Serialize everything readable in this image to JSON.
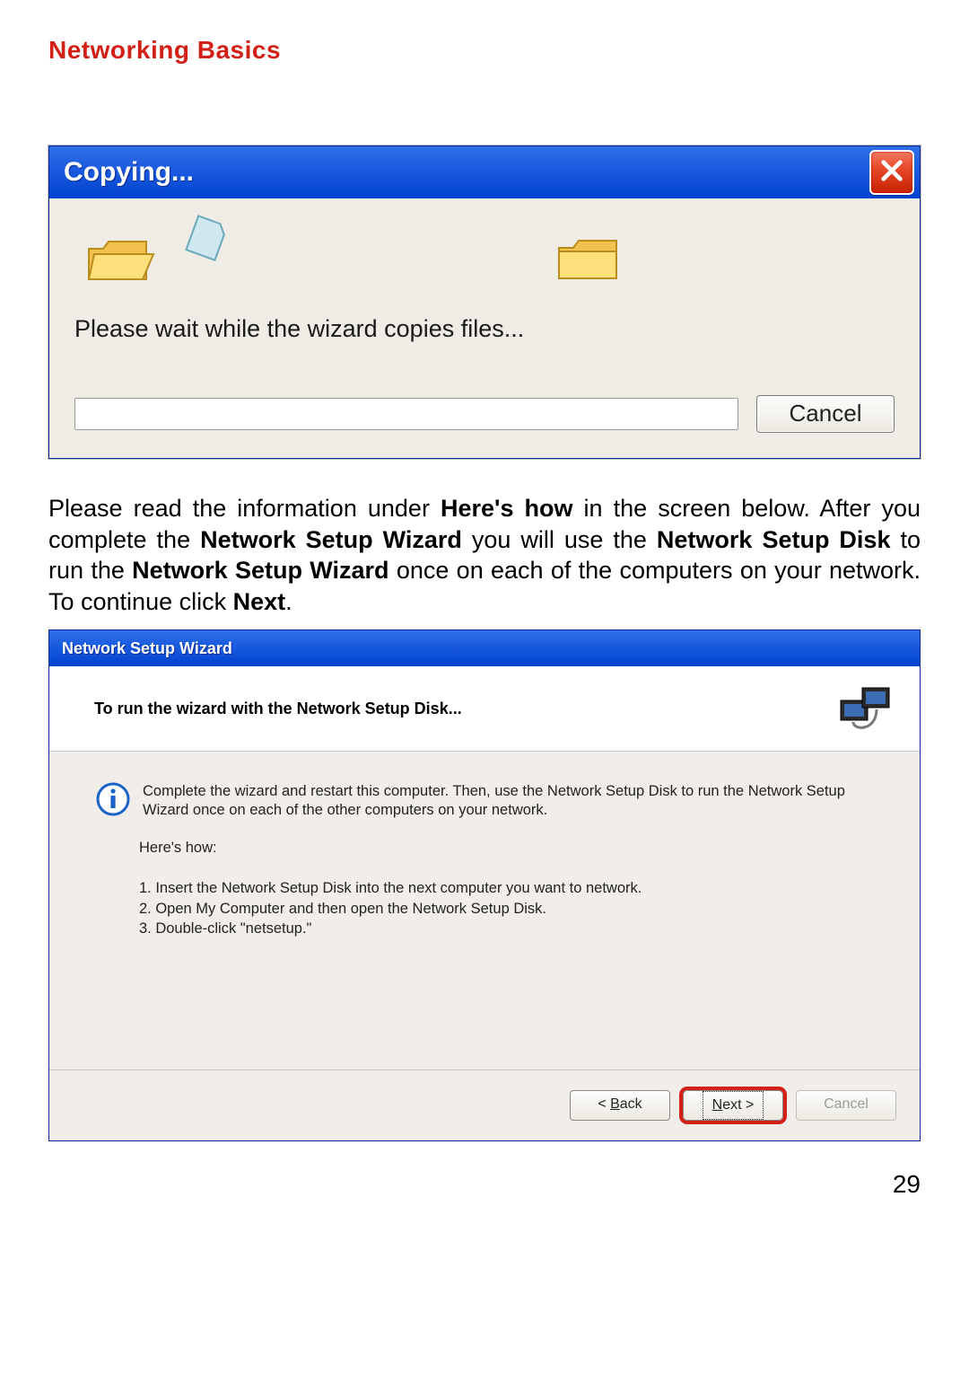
{
  "page_title": "Networking Basics",
  "page_number": "29",
  "copy_dialog": {
    "title": "Copying...",
    "message": "Please wait while the wizard copies files...",
    "cancel_label": "Cancel"
  },
  "paragraph": {
    "s1": "Please read the information under ",
    "b1": "Here's how",
    "s2": " in the screen below.  After you complete the ",
    "b2": "Network Setup Wizard",
    "s3": " you will use the ",
    "b3": "Network Setup Disk",
    "s4": " to run the ",
    "b4": "Network Setup Wizard",
    "s5": " once on each of the computers on your network.  To continue click ",
    "b5": "Next",
    "s6": "."
  },
  "wizard": {
    "title": "Network Setup Wizard",
    "header_text": "To run the wizard with the Network Setup Disk...",
    "info_text": "Complete the wizard and restart this computer. Then, use the Network Setup Disk to run the Network Setup Wizard once on each of the other computers on your network.",
    "heres_how_label": "Here's how:",
    "steps": {
      "s1": "1.  Insert the Network Setup Disk into the next computer you want to network.",
      "s2": "2.  Open My Computer and then open the Network Setup Disk.",
      "s3": "3.  Double-click \"netsetup.\""
    },
    "buttons": {
      "back_prefix": "< ",
      "back_u": "B",
      "back_rest": "ack",
      "next_u": "N",
      "next_rest": "ext >",
      "cancel": "Cancel"
    }
  }
}
